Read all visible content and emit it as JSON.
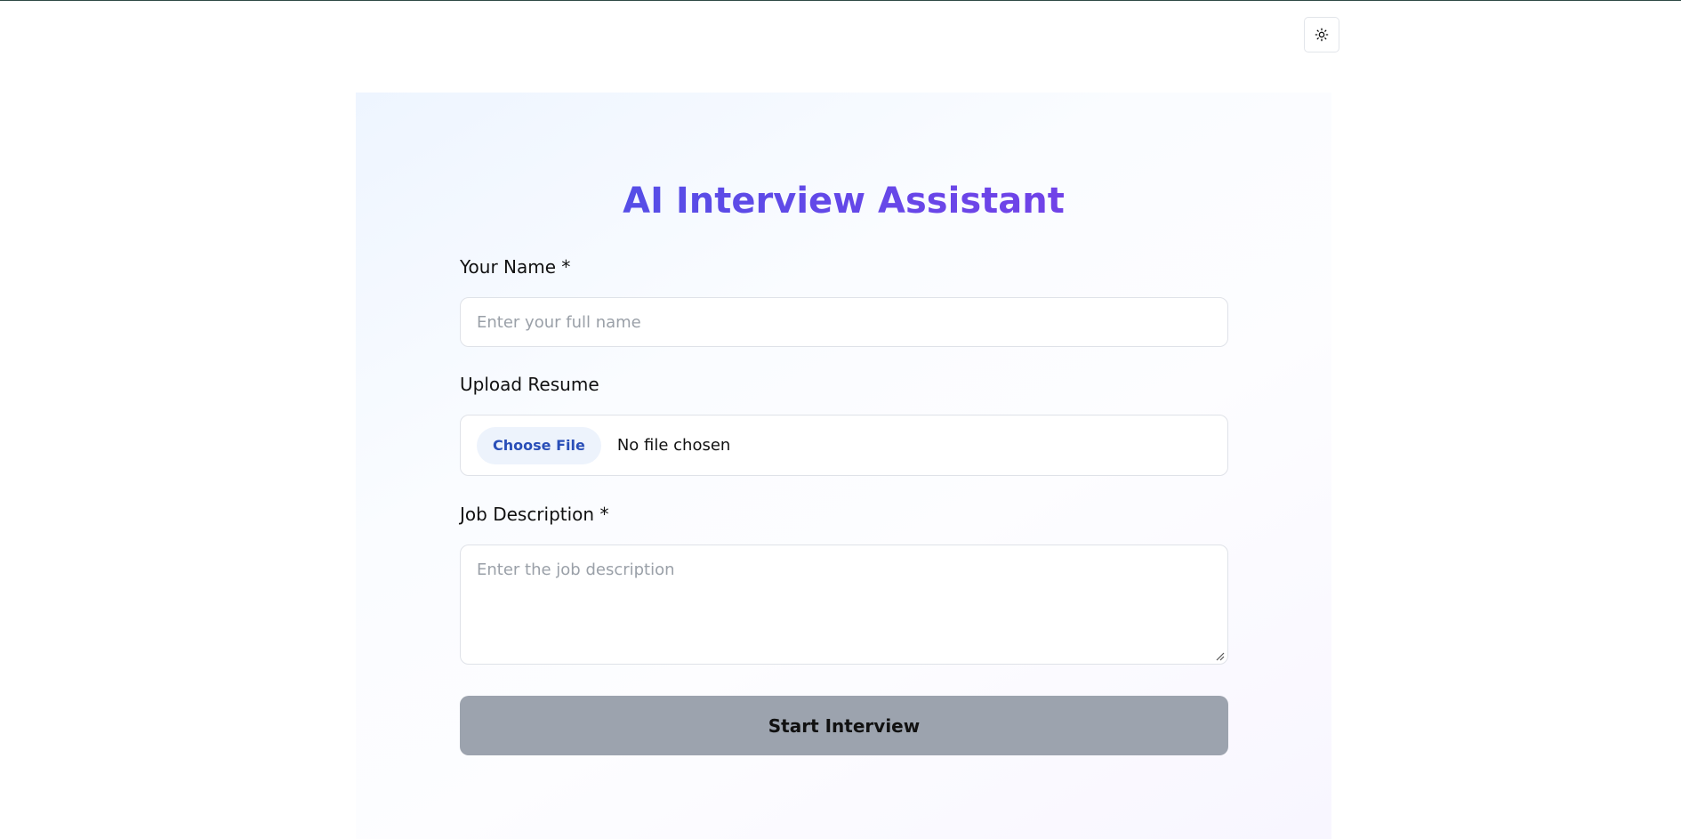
{
  "header": {
    "theme_toggle_icon": "sun-icon"
  },
  "form": {
    "title": "AI Interview Assistant",
    "name_label": "Your Name *",
    "name_placeholder": "Enter your full name",
    "name_value": "",
    "resume_label": "Upload Resume",
    "choose_file_label": "Choose File",
    "file_status": "No file chosen",
    "job_label": "Job Description *",
    "job_placeholder": "Enter the job description",
    "job_value": "",
    "submit_label": "Start Interview"
  },
  "colors": {
    "title_gradient_start": "#4454e6",
    "title_gradient_end": "#7d3ae6",
    "submit_disabled": "#9ca3ae",
    "choose_file_bg": "#edf3fc",
    "choose_file_text": "#2a4fb8"
  }
}
